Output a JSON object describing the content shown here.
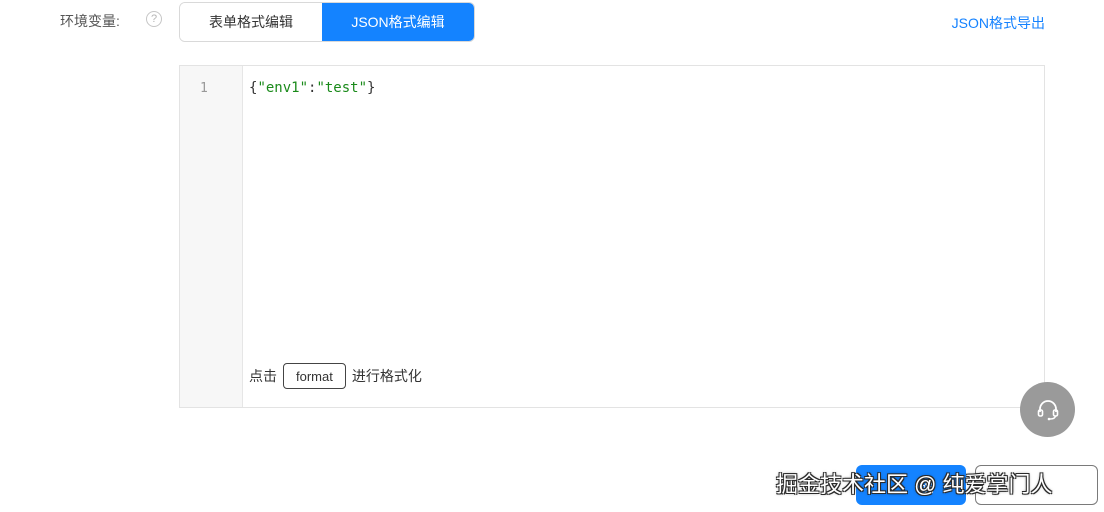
{
  "env_field": {
    "label": "环境变量:",
    "help_icon": "question-circle-icon",
    "help_glyph": "?"
  },
  "tabs": [
    {
      "label": "表单格式编辑",
      "active": false
    },
    {
      "label": "JSON格式编辑",
      "active": true
    }
  ],
  "export_link": "JSON格式导出",
  "editor": {
    "line_number": "1",
    "code": {
      "open_brace": "{",
      "key": "\"env1\"",
      "colon": ":",
      "value": "\"test\"",
      "close_brace": "}"
    },
    "hint_prefix": "点击",
    "format_button": "format",
    "hint_suffix": "进行格式化"
  },
  "support_icon": "headset-icon",
  "primary_button_label": "确",
  "watermark": "掘金技术社区 @ 纯爱掌门人",
  "colors": {
    "accent": "#1483ff",
    "string": "#1a8a1a",
    "support_bg": "#9a9a9a"
  }
}
